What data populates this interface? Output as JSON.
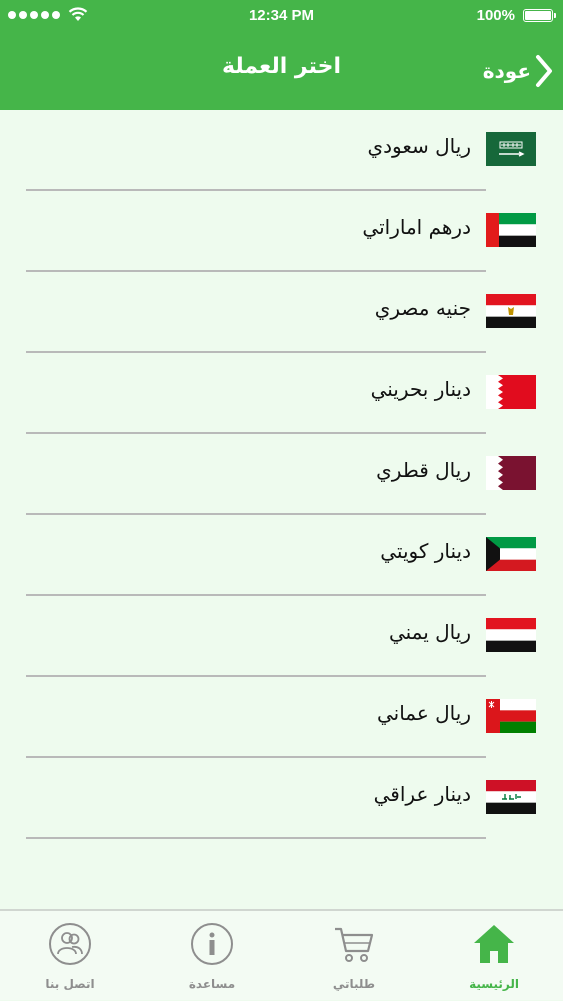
{
  "status_bar": {
    "time": "12:34 PM",
    "battery": "100%"
  },
  "nav": {
    "title": "اختر العملة",
    "back_label": "عودة"
  },
  "colors": {
    "brand": "#45b549",
    "background": "#eefbee",
    "tab_inactive": "#8e8e8e"
  },
  "currencies": [
    {
      "name": "ريال سعودي",
      "flag": "saudi-arabia-flag-icon"
    },
    {
      "name": "درهم اماراتي",
      "flag": "uae-flag-icon"
    },
    {
      "name": "جنيه مصري",
      "flag": "egypt-flag-icon"
    },
    {
      "name": "دينار بحريني",
      "flag": "bahrain-flag-icon"
    },
    {
      "name": "ريال قطري",
      "flag": "qatar-flag-icon"
    },
    {
      "name": "دينار كويتي",
      "flag": "kuwait-flag-icon"
    },
    {
      "name": "ريال يمني",
      "flag": "yemen-flag-icon"
    },
    {
      "name": "ريال عماني",
      "flag": "oman-flag-icon"
    },
    {
      "name": "دينار عراقي",
      "flag": "iraq-flag-icon"
    }
  ],
  "tabs": [
    {
      "label": "الرئيسية",
      "icon": "home-icon",
      "active": true
    },
    {
      "label": "طلباتي",
      "icon": "cart-icon",
      "active": false
    },
    {
      "label": "مساعدة",
      "icon": "info-icon",
      "active": false
    },
    {
      "label": "اتصل بنا",
      "icon": "contact-icon",
      "active": false
    }
  ]
}
